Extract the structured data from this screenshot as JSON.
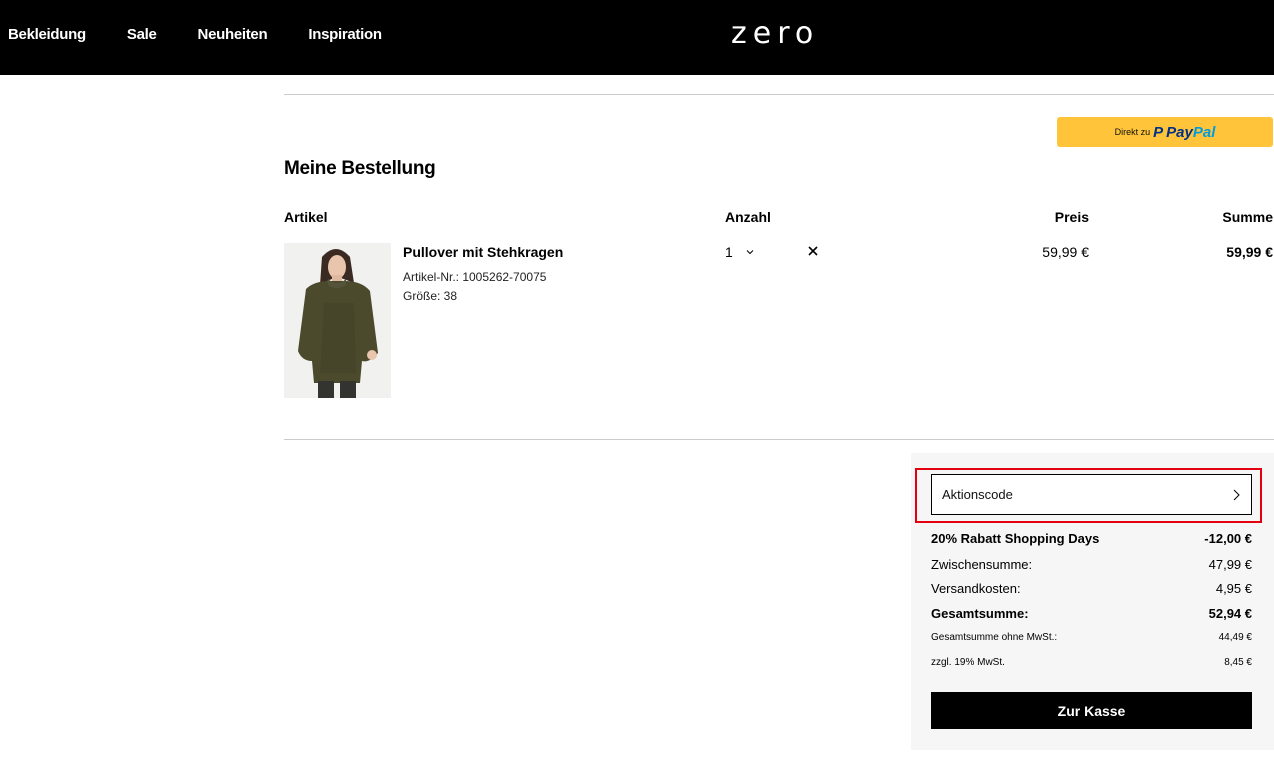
{
  "nav": {
    "items": [
      "Bekleidung",
      "Sale",
      "Neuheiten",
      "Inspiration"
    ],
    "logo": "zero"
  },
  "paypal": {
    "prefix": "Direkt zu",
    "brand_pay": "Pay",
    "brand_pal": "Pal"
  },
  "order": {
    "title": "Meine Bestellung",
    "headers": {
      "artikel": "Artikel",
      "anzahl": "Anzahl",
      "preis": "Preis",
      "summe": "Summe"
    },
    "item": {
      "name": "Pullover mit Stehkragen",
      "article_nr": "Artikel-Nr.: 1005262-70075",
      "size": "Größe: 38",
      "quantity": "1",
      "price": "59,99 €",
      "sum": "59,99 €",
      "image_icon": "sweater-product-image"
    }
  },
  "summary": {
    "promo_label": "Aktionscode",
    "discount_label": "20% Rabatt Shopping Days",
    "discount_value": "-12,00 €",
    "subtotal_label": "Zwischensumme:",
    "subtotal_value": "47,99 €",
    "shipping_label": "Versandkosten:",
    "shipping_value": "4,95 €",
    "total_label": "Gesamtsumme:",
    "total_value": "52,94 €",
    "net_label": "Gesamtsumme ohne MwSt.:",
    "net_value": "44,49 €",
    "vat_label": "zzgl. 19% MwSt.",
    "vat_value": "8,45 €",
    "checkout_label": "Zur Kasse"
  },
  "colors": {
    "header_bg": "#000000",
    "paypal_bg": "#ffc439",
    "highlight": "#e3000f",
    "summary_bg": "#f6f6f6"
  }
}
